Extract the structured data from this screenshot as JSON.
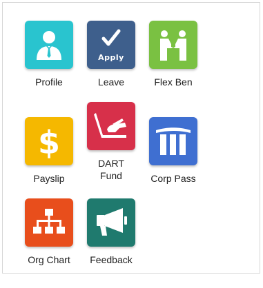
{
  "tiles": [
    {
      "label": "Profile",
      "icon": "user-profile-icon",
      "color": "#29c4cf"
    },
    {
      "label": "Leave",
      "icon": "apply-leave-icon",
      "color": "#3e5f8c",
      "icon_text": "Apply"
    },
    {
      "label": "Flex Ben",
      "icon": "handshake-icon",
      "color": "#7ac142"
    },
    {
      "label": "Payslip",
      "icon": "dollar-icon",
      "color": "#f5b800"
    },
    {
      "label_line1": "DART",
      "label_line2": "Fund",
      "icon": "laptop-hand-icon",
      "color": "#d7304a"
    },
    {
      "label": "Corp Pass",
      "icon": "building-icon",
      "color": "#3f6fd1"
    },
    {
      "label": "Org Chart",
      "icon": "org-chart-icon",
      "color": "#e84e1c"
    },
    {
      "label": "Feedback",
      "icon": "megaphone-icon",
      "color": "#1f7a6e"
    }
  ]
}
